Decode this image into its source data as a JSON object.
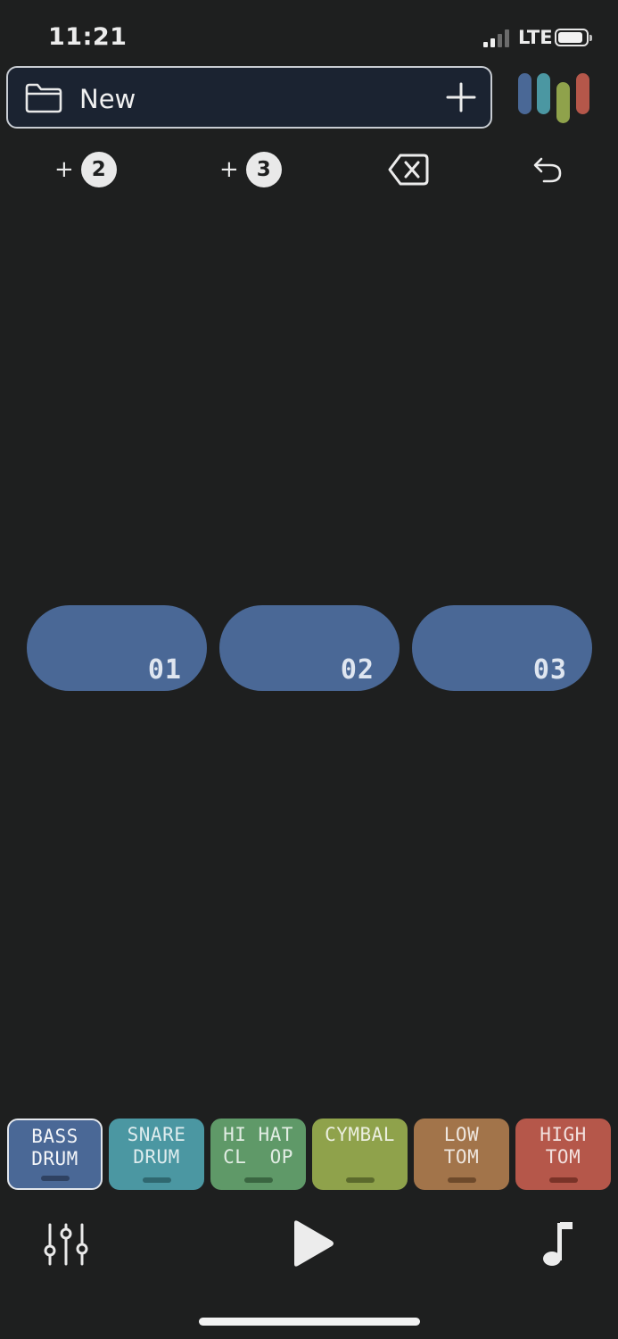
{
  "status_bar": {
    "time": "11:21",
    "carrier": "LTE"
  },
  "project": {
    "name": "New",
    "folder_icon": "folder-icon",
    "add_icon": "plus-icon"
  },
  "logo": {
    "colors": [
      "#4a6896",
      "#4b97a2",
      "#8fa24b",
      "#b5574a"
    ]
  },
  "toolbar": {
    "add_two": {
      "plus": "+",
      "count": "2"
    },
    "add_three": {
      "plus": "+",
      "count": "3"
    },
    "delete_icon": "backspace-icon",
    "undo_icon": "undo-icon"
  },
  "patterns": [
    {
      "label": "01"
    },
    {
      "label": "02"
    },
    {
      "label": "03"
    }
  ],
  "instruments": [
    {
      "line1": "BASS",
      "line2": "DRUM",
      "color": "#4a6896",
      "bar": "#2f4262",
      "selected": true
    },
    {
      "line1": "SNARE",
      "line2": "DRUM",
      "color": "#4b97a2",
      "bar": "#2f6870",
      "selected": false
    },
    {
      "line1": "HI HAT",
      "line2": "CL  OP",
      "color": "#5f9968",
      "bar": "#3a6641",
      "selected": false
    },
    {
      "line1": "CYMBAL",
      "line2": "",
      "color": "#8fa24b",
      "bar": "#5b6a2c",
      "selected": false
    },
    {
      "line1": "LOW",
      "line2": "TOM",
      "color": "#a2744a",
      "bar": "#6e4a2b",
      "selected": false
    },
    {
      "line1": "HIGH",
      "line2": "TOM",
      "color": "#b5574a",
      "bar": "#7a3328",
      "selected": false
    }
  ],
  "bottom_controls": {
    "mixer_icon": "sliders-icon",
    "play_icon": "play-icon",
    "music_icon": "music-note-icon"
  }
}
